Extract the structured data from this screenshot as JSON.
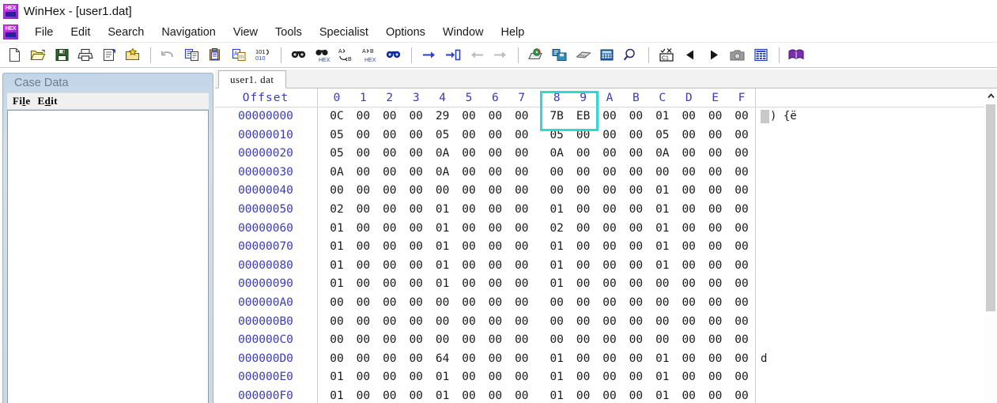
{
  "window": {
    "app_name": "WinHex",
    "title": "WinHex - [user1.dat]",
    "app_icon": "hex-logo-icon"
  },
  "menu": {
    "items": [
      {
        "label": "File",
        "name": "menu-file"
      },
      {
        "label": "Edit",
        "name": "menu-edit"
      },
      {
        "label": "Search",
        "name": "menu-search"
      },
      {
        "label": "Navigation",
        "name": "menu-navigation"
      },
      {
        "label": "View",
        "name": "menu-view"
      },
      {
        "label": "Tools",
        "name": "menu-tools"
      },
      {
        "label": "Specialist",
        "name": "menu-specialist"
      },
      {
        "label": "Options",
        "name": "menu-options"
      },
      {
        "label": "Window",
        "name": "menu-window"
      },
      {
        "label": "Help",
        "name": "menu-help"
      }
    ]
  },
  "toolbar": {
    "groups": [
      [
        "new-file-icon",
        "open-file-icon",
        "save-file-icon",
        "print-icon",
        "properties-icon",
        "create-disk-image-icon"
      ],
      [
        "undo-icon",
        "copy-icon",
        "paste-icon",
        "paste-into-new-icon",
        "convert-binary-icon"
      ],
      [
        "find-text-icon",
        "find-hex-icon",
        "replace-text-icon",
        "replace-hex-icon",
        "find-all-icon"
      ],
      [
        "goto-offset-icon",
        "goto-position-icon",
        "back-arrow-icon",
        "forward-arrow-icon"
      ],
      [
        "open-disk-icon",
        "open-ram-icon",
        "open-memory-icon",
        "calculator-icon",
        "zoom-icon"
      ],
      [
        "checksum-icon",
        "prev-page-icon",
        "next-page-icon",
        "snapshot-icon",
        "data-interpreter-icon"
      ],
      [
        "help-book-icon"
      ]
    ]
  },
  "case_panel": {
    "title": "Case Data",
    "menu": [
      {
        "label": "File",
        "accel": "l",
        "name": "case-menu-file"
      },
      {
        "label": "Edit",
        "accel": "d",
        "name": "case-menu-edit"
      }
    ],
    "body_content": ""
  },
  "document": {
    "tab_label": "user1. dat",
    "active_tab": "user1.dat"
  },
  "hex_view": {
    "offset_header": "Offset",
    "column_headers": [
      "0",
      "1",
      "2",
      "3",
      "4",
      "5",
      "6",
      "7",
      "8",
      "9",
      "A",
      "B",
      "C",
      "D",
      "E",
      "F"
    ],
    "selection": {
      "columns": [
        "8",
        "9"
      ],
      "row_offset": "00000000",
      "bytes": [
        "7B",
        "EB"
      ],
      "highlight_color": "#2fd9d2"
    },
    "cursor_offset": "00000000",
    "rows": [
      {
        "offset": "00000000",
        "bytes": [
          "0C",
          "00",
          "00",
          "00",
          "29",
          "00",
          "00",
          "00",
          "7B",
          "EB",
          "00",
          "00",
          "01",
          "00",
          "00",
          "00"
        ],
        "ascii": "█   )   {ë"
      },
      {
        "offset": "00000010",
        "bytes": [
          "05",
          "00",
          "00",
          "00",
          "05",
          "00",
          "00",
          "00",
          "05",
          "00",
          "00",
          "00",
          "05",
          "00",
          "00",
          "00"
        ],
        "ascii": ""
      },
      {
        "offset": "00000020",
        "bytes": [
          "05",
          "00",
          "00",
          "00",
          "0A",
          "00",
          "00",
          "00",
          "0A",
          "00",
          "00",
          "00",
          "0A",
          "00",
          "00",
          "00"
        ],
        "ascii": ""
      },
      {
        "offset": "00000030",
        "bytes": [
          "0A",
          "00",
          "00",
          "00",
          "0A",
          "00",
          "00",
          "00",
          "00",
          "00",
          "00",
          "00",
          "00",
          "00",
          "00",
          "00"
        ],
        "ascii": ""
      },
      {
        "offset": "00000040",
        "bytes": [
          "00",
          "00",
          "00",
          "00",
          "00",
          "00",
          "00",
          "00",
          "00",
          "00",
          "00",
          "00",
          "01",
          "00",
          "00",
          "00"
        ],
        "ascii": ""
      },
      {
        "offset": "00000050",
        "bytes": [
          "02",
          "00",
          "00",
          "00",
          "01",
          "00",
          "00",
          "00",
          "01",
          "00",
          "00",
          "00",
          "01",
          "00",
          "00",
          "00"
        ],
        "ascii": ""
      },
      {
        "offset": "00000060",
        "bytes": [
          "01",
          "00",
          "00",
          "00",
          "01",
          "00",
          "00",
          "00",
          "02",
          "00",
          "00",
          "00",
          "01",
          "00",
          "00",
          "00"
        ],
        "ascii": ""
      },
      {
        "offset": "00000070",
        "bytes": [
          "01",
          "00",
          "00",
          "00",
          "01",
          "00",
          "00",
          "00",
          "01",
          "00",
          "00",
          "00",
          "01",
          "00",
          "00",
          "00"
        ],
        "ascii": ""
      },
      {
        "offset": "00000080",
        "bytes": [
          "01",
          "00",
          "00",
          "00",
          "01",
          "00",
          "00",
          "00",
          "01",
          "00",
          "00",
          "00",
          "01",
          "00",
          "00",
          "00"
        ],
        "ascii": ""
      },
      {
        "offset": "00000090",
        "bytes": [
          "01",
          "00",
          "00",
          "00",
          "01",
          "00",
          "00",
          "00",
          "01",
          "00",
          "00",
          "00",
          "00",
          "00",
          "00",
          "00"
        ],
        "ascii": ""
      },
      {
        "offset": "000000A0",
        "bytes": [
          "00",
          "00",
          "00",
          "00",
          "00",
          "00",
          "00",
          "00",
          "00",
          "00",
          "00",
          "00",
          "00",
          "00",
          "00",
          "00"
        ],
        "ascii": ""
      },
      {
        "offset": "000000B0",
        "bytes": [
          "00",
          "00",
          "00",
          "00",
          "00",
          "00",
          "00",
          "00",
          "00",
          "00",
          "00",
          "00",
          "00",
          "00",
          "00",
          "00"
        ],
        "ascii": ""
      },
      {
        "offset": "000000C0",
        "bytes": [
          "00",
          "00",
          "00",
          "00",
          "00",
          "00",
          "00",
          "00",
          "00",
          "00",
          "00",
          "00",
          "00",
          "00",
          "00",
          "00"
        ],
        "ascii": ""
      },
      {
        "offset": "000000D0",
        "bytes": [
          "00",
          "00",
          "00",
          "00",
          "64",
          "00",
          "00",
          "00",
          "01",
          "00",
          "00",
          "00",
          "01",
          "00",
          "00",
          "00"
        ],
        "ascii": "    d"
      },
      {
        "offset": "000000E0",
        "bytes": [
          "01",
          "00",
          "00",
          "00",
          "01",
          "00",
          "00",
          "00",
          "01",
          "00",
          "00",
          "00",
          "01",
          "00",
          "00",
          "00"
        ],
        "ascii": ""
      },
      {
        "offset": "000000F0",
        "bytes": [
          "01",
          "00",
          "00",
          "00",
          "01",
          "00",
          "00",
          "00",
          "01",
          "00",
          "00",
          "00",
          "01",
          "00",
          "00",
          "00"
        ],
        "ascii": ""
      }
    ]
  },
  "scrollbar": {
    "up_arrow": "chevron-up-icon",
    "thumb_position_percent": 2
  },
  "colors": {
    "offset_text": "#3a3ac0",
    "header_text": "#3a3ac0",
    "byte_text": "#1a1a1a",
    "selection_border": "#2fd9d2",
    "panel_gradient_top": "#c3d5e8",
    "cursor_block": "#c8c8c8"
  }
}
